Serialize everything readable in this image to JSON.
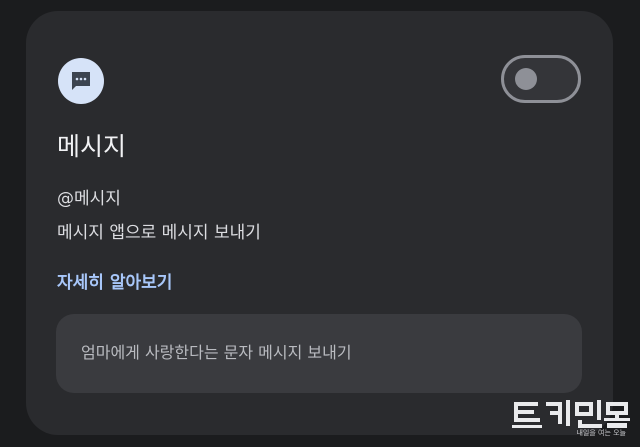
{
  "card": {
    "app_icon": "message-dots-icon",
    "toggle_state": "off",
    "title": "메시지",
    "handle": "@메시지",
    "description": "메시지 앱으로 메시지 보내기",
    "learn_more": "자세히 알아보기",
    "example": "엄마에게 사랑한다는 문자 메시지 보내기"
  },
  "watermark": {
    "subtitle": "내일을 여는 오늘"
  },
  "colors": {
    "background": "#1b1c1e",
    "card": "#2a2b2e",
    "accent_link": "#a8c7fa",
    "icon_bg": "#d6e3f8"
  }
}
